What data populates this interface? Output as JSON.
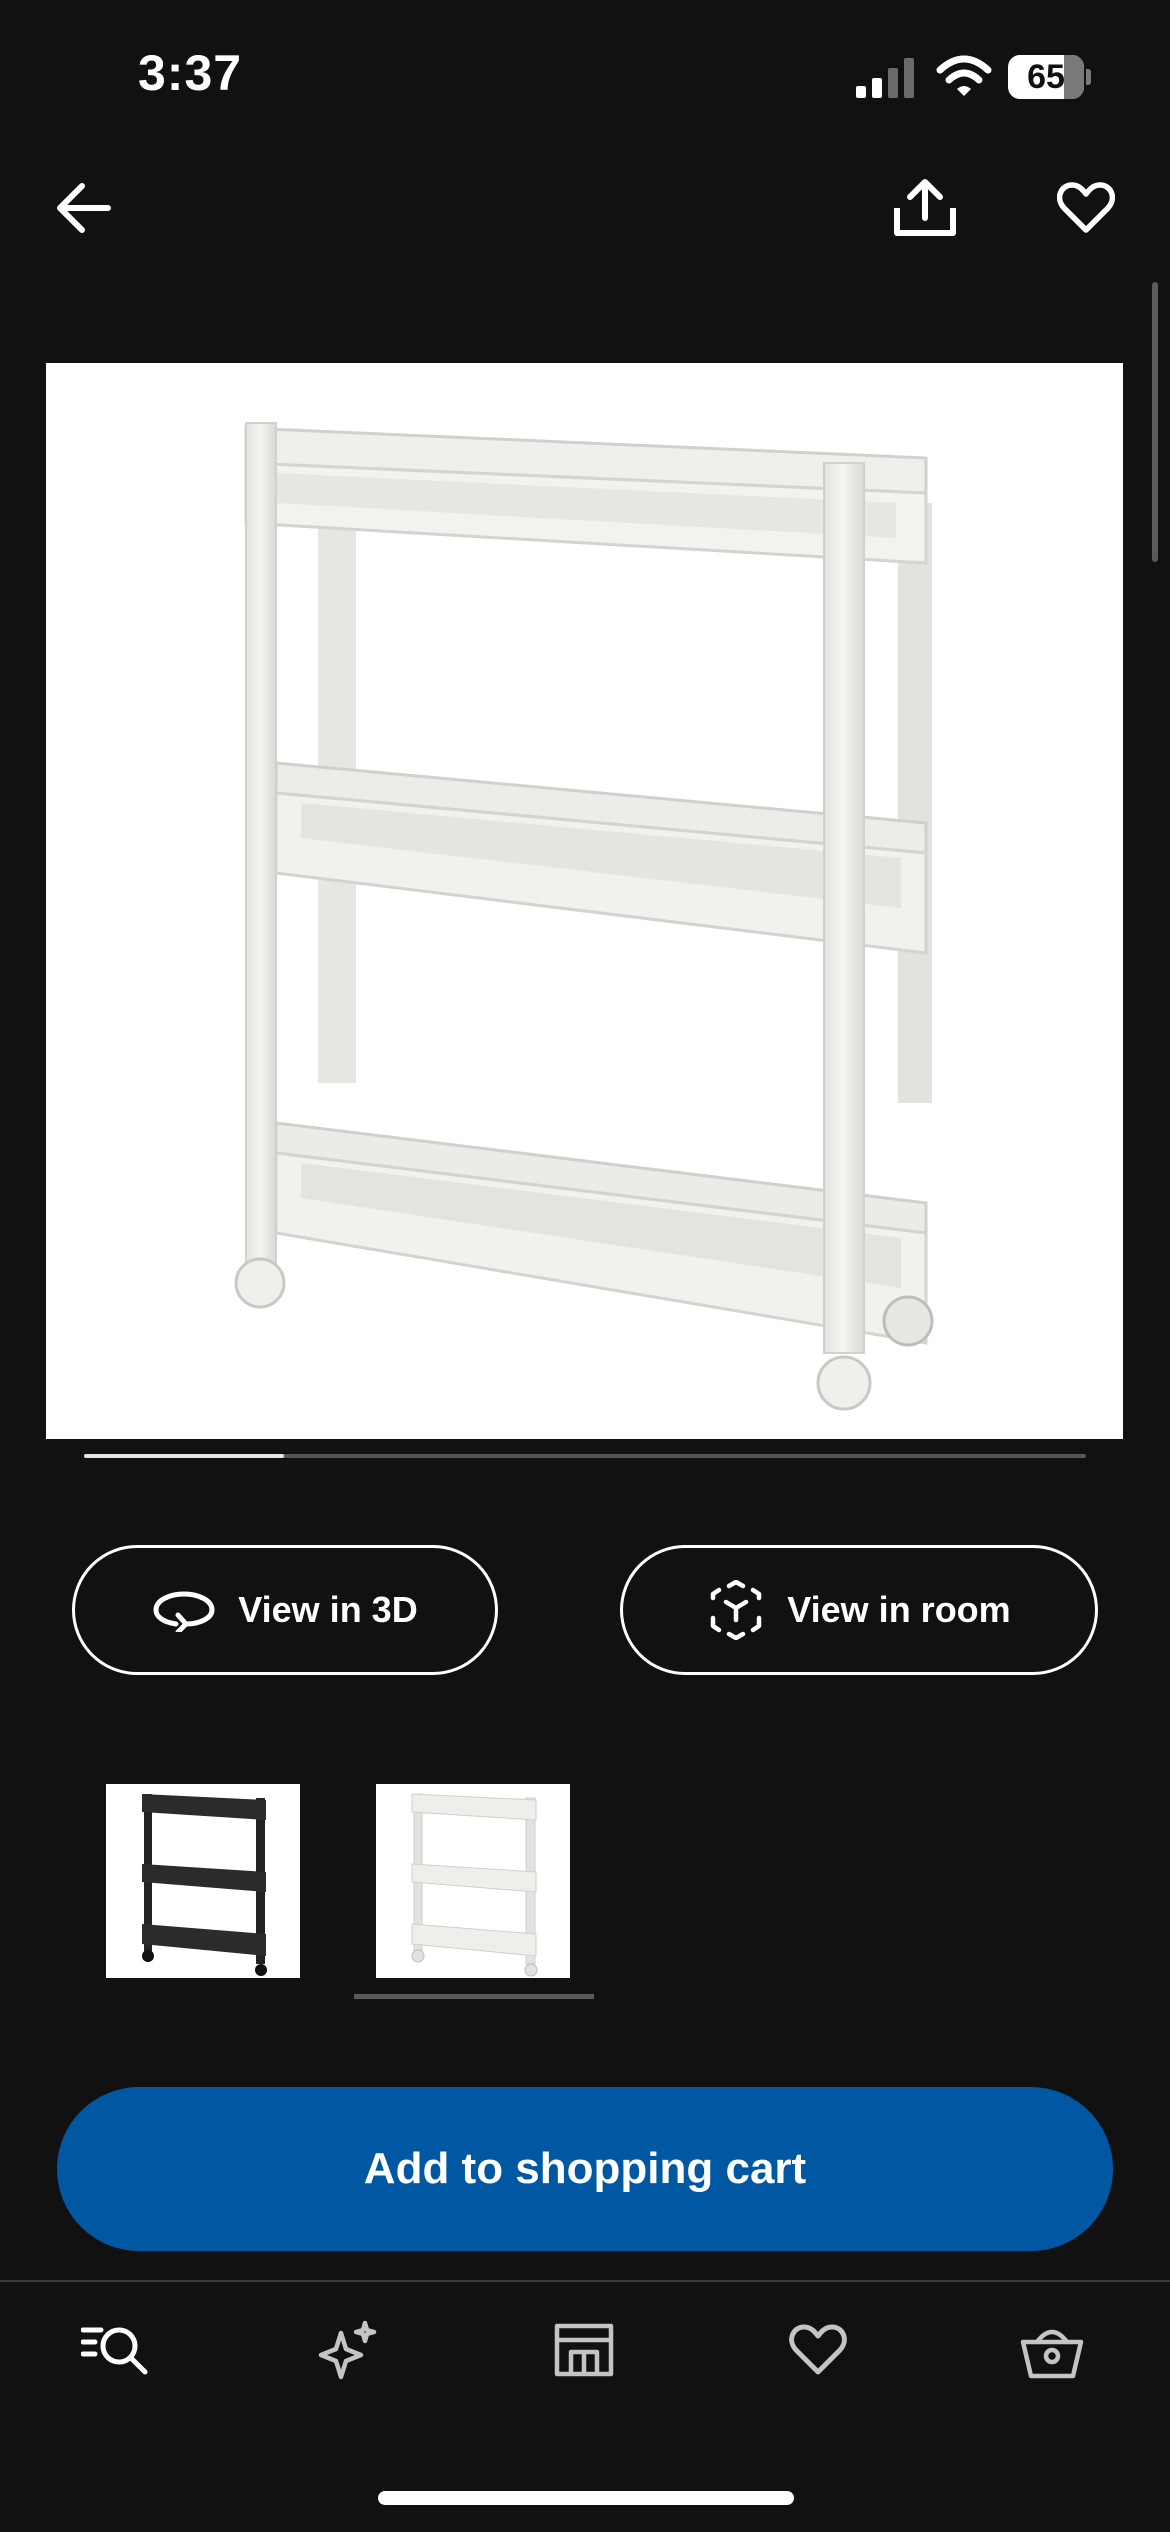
{
  "status_bar": {
    "time": "3:37",
    "battery_level": "65",
    "signal_strength_bars": 2,
    "icons": [
      "cellular-signal-icon",
      "wifi-icon",
      "battery-icon"
    ]
  },
  "top_nav": {
    "icons": [
      "back-arrow-icon",
      "share-icon",
      "heart-icon"
    ]
  },
  "product": {
    "image_alt": "white three-shelf trolley on wheels",
    "carousel_progress": 0.2
  },
  "actions": {
    "view_3d_label": "View in 3D",
    "view_room_label": "View in room"
  },
  "variants": [
    {
      "color": "black",
      "selected": false
    },
    {
      "color": "white",
      "selected": true
    }
  ],
  "cart": {
    "add_label": "Add to shopping cart",
    "button_color": "#0058a3"
  },
  "tab_bar": {
    "items": [
      {
        "icon": "search-icon"
      },
      {
        "icon": "sparkle-icon"
      },
      {
        "icon": "store-icon"
      },
      {
        "icon": "heart-icon"
      },
      {
        "icon": "basket-icon"
      }
    ]
  }
}
